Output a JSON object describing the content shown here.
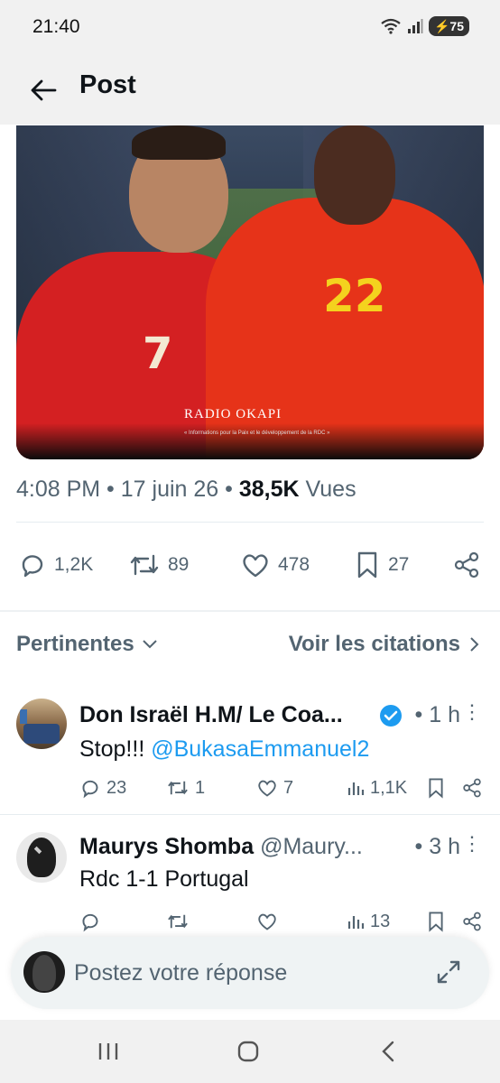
{
  "status_bar": {
    "time": "21:40",
    "battery": "75"
  },
  "header": {
    "title": "Post"
  },
  "media": {
    "logo_text": "RADIO OKAPI",
    "logo_subtitle": "« Informations pour la Paix et le développement de la RDC »",
    "number_left": "7",
    "number_right": "22"
  },
  "post_meta": {
    "time": "4:08 PM",
    "date": "17 juin 26",
    "views_count": "38,5K",
    "views_label": "Vues"
  },
  "actions": {
    "replies": "1,2K",
    "reposts": "89",
    "likes": "478",
    "bookmarks": "27"
  },
  "filters": {
    "sort_label": "Pertinentes",
    "quotes_label": "Voir les citations"
  },
  "replies": [
    {
      "name": "Don Israël H.M/ Le Coa...",
      "handle": "",
      "time": "1 h",
      "text": "Stop!!! ",
      "mention": "@BukasaEmmanuel2",
      "stats": {
        "replies": "23",
        "reposts": "1",
        "likes": "7",
        "views": "1,1K"
      }
    },
    {
      "name": "Maurys Shomba",
      "handle": "@Maury...",
      "time": "3 h",
      "text": "Rdc 1-1 Portugal",
      "mention": "",
      "stats": {
        "replies": "",
        "reposts": "",
        "likes": "",
        "views": "13"
      }
    }
  ],
  "compose": {
    "placeholder": "Postez votre réponse"
  },
  "colors": {
    "accent": "#1d9bf0",
    "muted": "#536471",
    "text": "#0f1419",
    "verified": "#1d9bf0"
  }
}
